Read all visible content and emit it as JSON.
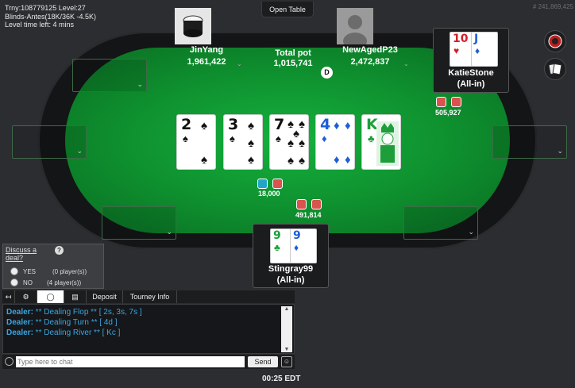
{
  "tournament": {
    "line1": "Trny:108779125 Level:27",
    "line2": "Blinds-Antes(18K/36K -4.5K)",
    "line3": "Level time left: 4 mins"
  },
  "header": {
    "open_table": "Open Table",
    "hand_id": "# 241,869,425"
  },
  "pot": {
    "label": "Total pot",
    "amount": "1,015,741"
  },
  "dealer_button": "D",
  "board": [
    {
      "rank": "2",
      "suit": "♠",
      "color": "black"
    },
    {
      "rank": "3",
      "suit": "♠",
      "color": "black"
    },
    {
      "rank": "7",
      "suit": "♠",
      "color": "black"
    },
    {
      "rank": "4",
      "suit": "♦",
      "color": "blue"
    },
    {
      "rank": "K",
      "suit": "♣",
      "color": "green"
    }
  ],
  "players": {
    "jinyang": {
      "name": "JinYang",
      "stack": "1,961,422"
    },
    "newaged": {
      "name": "NewAgedP23",
      "stack": "2,472,837"
    },
    "katie": {
      "name": "KatieStone",
      "status": "(All-in)",
      "bet": "505,927",
      "cards": [
        {
          "rank": "10",
          "suit": "♥"
        },
        {
          "rank": "J",
          "suit": "♦"
        }
      ]
    },
    "hero": {
      "name": "Stingray99",
      "status": "(All-in)",
      "bet": "491,814",
      "cards": [
        {
          "rank": "9",
          "suit": "♣"
        },
        {
          "rank": "9",
          "suit": "♦"
        }
      ]
    }
  },
  "center_bet": "18,000",
  "deal": {
    "title_a": "Discuss a",
    "title_b": "deal?",
    "help": "?",
    "yes": "YES",
    "yes_count": "(0 player(s))",
    "no": "NO",
    "no_count": "(4 player(s))"
  },
  "tabs": {
    "deposit": "Deposit",
    "tourney_info": "Tourney Info"
  },
  "chat": {
    "lines": [
      {
        "who": "Dealer:",
        "msg": " ** Dealing Flop ** [ 2s, 3s, 7s ]"
      },
      {
        "who": "Dealer:",
        "msg": " ** Dealing Turn ** [ 4d ]"
      },
      {
        "who": "Dealer:",
        "msg": " ** Dealing River ** [ Kc ]"
      }
    ],
    "placeholder": "Type here to chat",
    "send": "Send"
  },
  "clock": "00:25 EDT"
}
